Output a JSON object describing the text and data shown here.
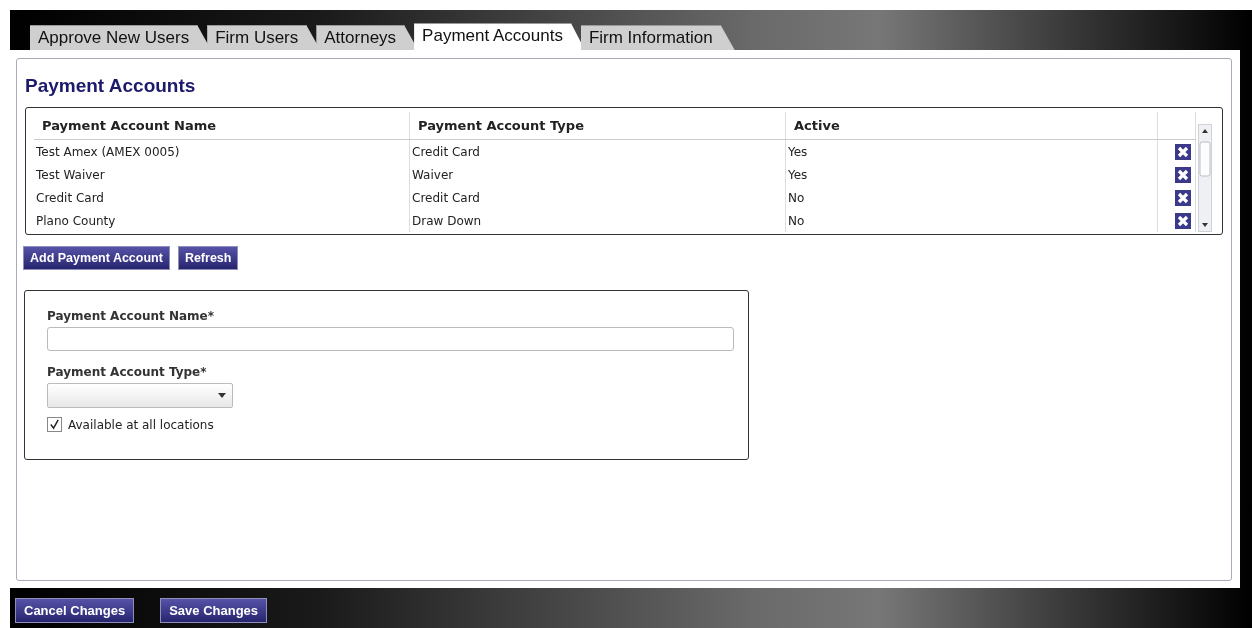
{
  "tabs": [
    {
      "label": "Approve New Users",
      "selected": false
    },
    {
      "label": "Firm Users",
      "selected": false
    },
    {
      "label": "Attorneys",
      "selected": false
    },
    {
      "label": "Payment Accounts",
      "selected": true
    },
    {
      "label": "Firm Information",
      "selected": false
    }
  ],
  "heading": "Payment Accounts",
  "table": {
    "columns": [
      "Payment Account Name",
      "Payment Account Type",
      "Active"
    ],
    "rows": [
      {
        "cells": [
          "Test Amex (AMEX 0005)",
          "Credit Card",
          "Yes"
        ]
      },
      {
        "cells": [
          "Test Waiver",
          "Waiver",
          "Yes"
        ]
      },
      {
        "cells": [
          "Credit Card",
          "Credit Card",
          "No"
        ]
      },
      {
        "cells": [
          "Plano County",
          "Draw Down",
          "No"
        ]
      }
    ]
  },
  "table_buttons": [
    "Add Payment Account",
    "Refresh"
  ],
  "form": {
    "name_label": "Payment Account Name*",
    "type_label": "Payment Account Type*",
    "checkbox": {
      "label": "Available at all locations",
      "checked": true
    }
  },
  "footer_buttons": [
    "Cancel Changes",
    "Save Changes"
  ]
}
